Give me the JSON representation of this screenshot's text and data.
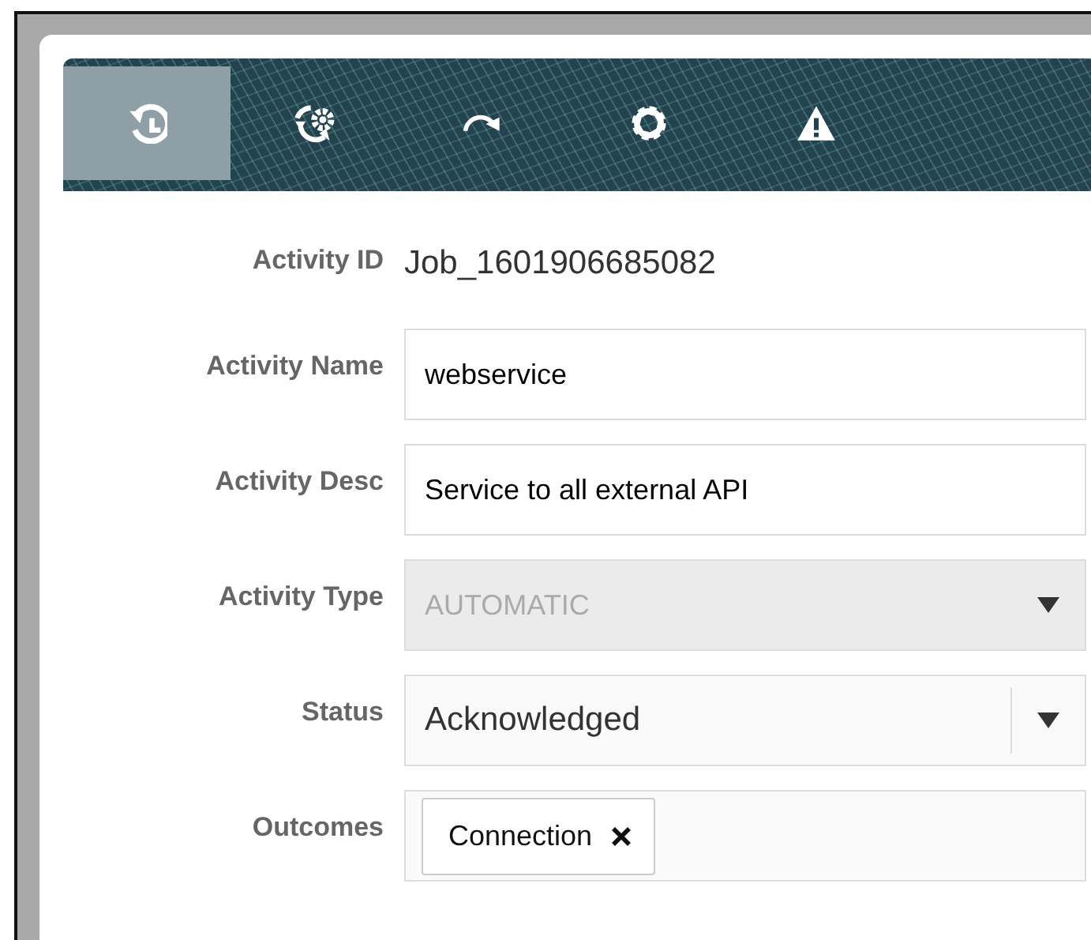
{
  "tabs": [
    {
      "kind": "history",
      "selected": true
    },
    {
      "kind": "sync-settings",
      "selected": false
    },
    {
      "kind": "redo",
      "selected": false
    },
    {
      "kind": "settings",
      "selected": false
    },
    {
      "kind": "warning",
      "selected": false
    }
  ],
  "fields": [
    {
      "label": "Activity ID",
      "kind": "text",
      "value": "Job_1601906685082"
    },
    {
      "label": "Activity Name",
      "kind": "input",
      "value": "webservice"
    },
    {
      "label": "Activity Desc",
      "kind": "input",
      "value": "Service to all external API"
    },
    {
      "label": "Activity Type",
      "kind": "select",
      "value": "AUTOMATIC",
      "disabled": true
    },
    {
      "label": "Status",
      "kind": "select",
      "value": "Acknowledged",
      "disabled": false
    },
    {
      "label": "Outcomes",
      "kind": "tags",
      "tags": [
        "Connection"
      ]
    }
  ]
}
